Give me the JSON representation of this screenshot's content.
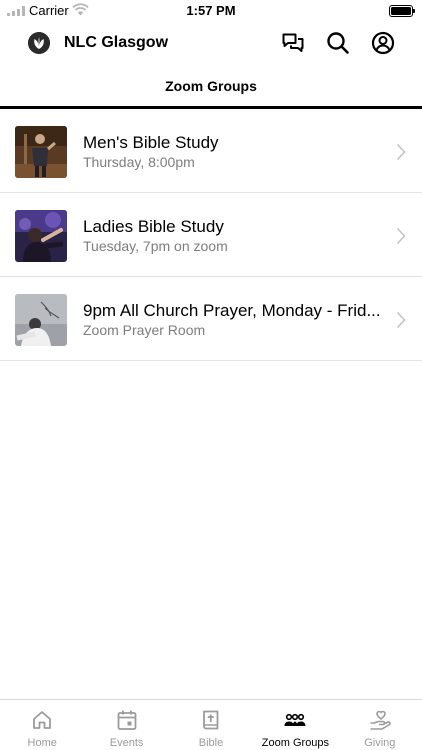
{
  "status_bar": {
    "carrier": "Carrier",
    "time": "1:57 PM",
    "signal_icon": "signal-icon",
    "wifi_icon": "wifi-icon",
    "battery_icon": "battery-icon"
  },
  "header": {
    "title": "NLC Glasgow",
    "logo_icon": "church-logo-icon",
    "actions": [
      "chat-icon",
      "search-icon",
      "profile-icon"
    ]
  },
  "page": {
    "title": "Zoom Groups"
  },
  "groups": [
    {
      "title": "Men's Bible Study",
      "subtitle": "Thursday, 8:00pm",
      "thumbnail": "speaker-photo"
    },
    {
      "title": "Ladies Bible Study",
      "subtitle": "Tuesday, 7pm on zoom",
      "thumbnail": "worship-photo"
    },
    {
      "title": "9pm All Church Prayer, Monday - Frid...",
      "subtitle": "Zoom Prayer Room",
      "thumbnail": "prayer-photo"
    }
  ],
  "tab_bar": {
    "tabs": [
      {
        "label": "Home",
        "icon": "home-icon",
        "active": false
      },
      {
        "label": "Events",
        "icon": "calendar-icon",
        "active": false
      },
      {
        "label": "Bible",
        "icon": "bible-icon",
        "active": false
      },
      {
        "label": "Zoom Groups",
        "icon": "groups-icon",
        "active": true
      },
      {
        "label": "Giving",
        "icon": "giving-heart-icon",
        "active": false
      }
    ]
  },
  "colors": {
    "accent": "#000000",
    "inactive_tab": "#9b9b9b",
    "subtitle": "#7d7d7d",
    "divider": "#e3e3e3"
  }
}
